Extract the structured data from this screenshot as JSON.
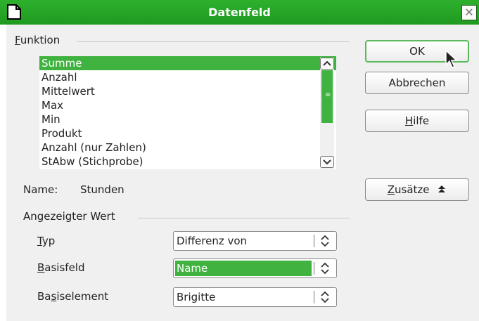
{
  "window": {
    "title": "Datenfeld"
  },
  "funktion": {
    "label": "Funktion",
    "items": [
      "Summe",
      "Anzahl",
      "Mittelwert",
      "Max",
      "Min",
      "Produkt",
      "Anzahl (nur Zahlen)",
      "StAbw (Stichprobe)"
    ],
    "selected": "Summe"
  },
  "name": {
    "label": "Name:",
    "value": "Stunden"
  },
  "angezeigter_wert": {
    "label": "Angezeigter Wert",
    "typ": {
      "label": "Typ",
      "value": "Differenz von"
    },
    "basisfeld": {
      "label": "Basisfeld",
      "value": "Name"
    },
    "basiselement": {
      "label": "Basiselement",
      "value": "Brigitte"
    }
  },
  "buttons": {
    "ok": "OK",
    "abbrechen": "Abbrechen",
    "hilfe": "Hilfe",
    "zusaetze": "Zusätze"
  },
  "icons": [
    "document-icon",
    "close-icon",
    "scroll-up-icon",
    "scroll-down-icon",
    "spin-icon",
    "chevron-up-icon",
    "mouse-cursor-icon"
  ],
  "colors": {
    "accent": "#3fb23f",
    "titlebar": "#2aa82a",
    "dialog_bg": "#f0f0f0"
  }
}
